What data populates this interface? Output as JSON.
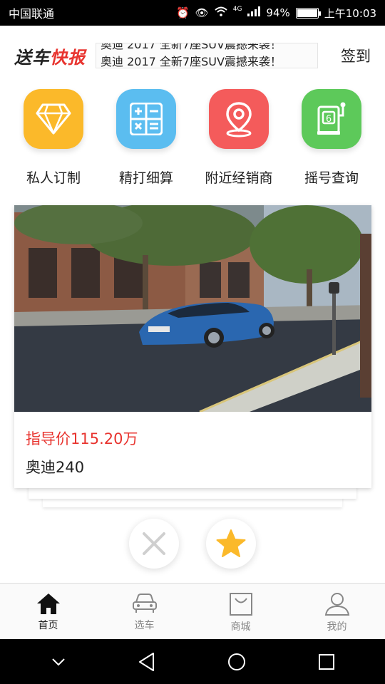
{
  "status_bar": {
    "carrier": "中国联通",
    "network": "4G",
    "battery": "94%",
    "battery_level": 0.94,
    "time": "上午10:03"
  },
  "header": {
    "logo_part1": "送车",
    "logo_part2": "快报",
    "news": [
      "奥迪 2017 全新7座SUV震撼来袭！",
      "奥迪 2017 全新7座SUV震撼来袭！"
    ],
    "signin_label": "签到"
  },
  "quick_actions": [
    {
      "label": "私人订制",
      "icon": "diamond-icon",
      "color": "#fbb92a"
    },
    {
      "label": "精打细算",
      "icon": "calculator-icon",
      "color": "#5bbdf0"
    },
    {
      "label": "附近经销商",
      "icon": "location-pin-icon",
      "color": "#f45b5b"
    },
    {
      "label": "摇号查询",
      "icon": "lottery-machine-icon",
      "color": "#5dc95a"
    }
  ],
  "card": {
    "price": "指导价115.20万",
    "name": "奥迪240",
    "image": "car-photo"
  },
  "actions": {
    "dislike_icon": "close-icon",
    "favorite_icon": "star-icon",
    "star_color": "#fbb92a"
  },
  "tabs": [
    {
      "label": "首页",
      "icon": "home-icon",
      "active": true
    },
    {
      "label": "选车",
      "icon": "car-icon",
      "active": false
    },
    {
      "label": "商城",
      "icon": "shopping-bag-icon",
      "active": false
    },
    {
      "label": "我的",
      "icon": "user-icon",
      "active": false
    }
  ],
  "nav_bar": {
    "icons": [
      "chevron-down-icon",
      "back-triangle-icon",
      "home-circle-icon",
      "recents-square-icon"
    ]
  }
}
